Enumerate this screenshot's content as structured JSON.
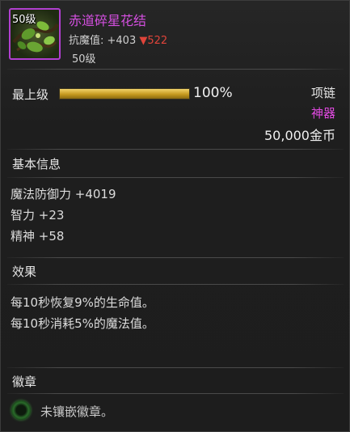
{
  "header": {
    "level_badge": "50级",
    "item_name": "赤道碎星花结",
    "stat_label": "抗魔值: +403",
    "stat_drop_arrow": "▼",
    "stat_drop_value": "522",
    "level_tag": "50级"
  },
  "progress": {
    "tier_label": "最上级",
    "percent_text": "100%",
    "fill_fraction": 1.0
  },
  "item_info": {
    "slot": "项链",
    "rarity": "神器",
    "price": "50,000金币"
  },
  "basic_info": {
    "title": "基本信息",
    "stats": [
      "魔法防御力 +4019",
      "智力 +23",
      "精神 +58"
    ]
  },
  "effects": {
    "title": "效果",
    "lines": [
      "每10秒恢复9%的生命值。",
      "每10秒消耗5%的魔法值。"
    ]
  },
  "badge": {
    "title": "徽章",
    "empty_text": "未镶嵌徽章。"
  },
  "colors": {
    "rarity": "#e04ae0",
    "item_name": "#d44fe0",
    "stat_drop": "#e0443a",
    "bar_fill": "#d9b23a"
  },
  "icons": {
    "item": "vine-flower-knot-icon",
    "badge_slot": "empty-badge-slot-icon"
  }
}
